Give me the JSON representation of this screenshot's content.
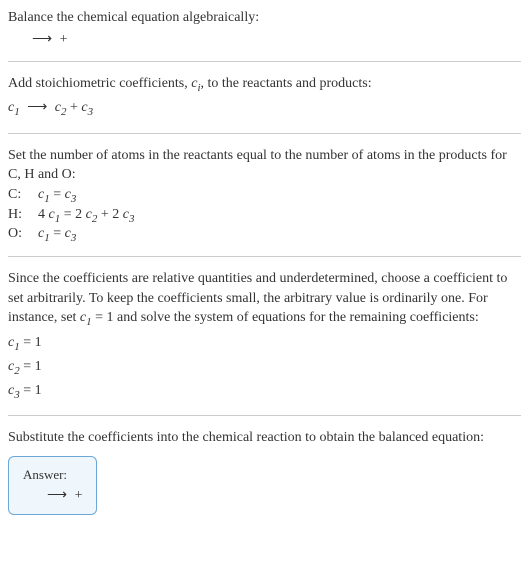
{
  "section1": {
    "line1": "Balance the chemical equation algebraically:",
    "line2_arrow": "⟶",
    "line2_plus": "+"
  },
  "section2": {
    "line1_a": "Add stoichiometric coefficients, ",
    "line1_ci": "c",
    "line1_ci_sub": "i",
    "line1_b": ", to the reactants and products:",
    "line2_c1": "c",
    "line2_c1_sub": "1",
    "line2_arrow": "⟶",
    "line2_c2": "c",
    "line2_c2_sub": "2",
    "line2_plus": " + ",
    "line2_c3": "c",
    "line2_c3_sub": "3"
  },
  "section3": {
    "line1": "Set the number of atoms in the reactants equal to the number of atoms in the products for C, H and O:",
    "eqs": [
      {
        "label": "C:",
        "lhs_c": "c",
        "lhs_sub": "1",
        "eq": " = ",
        "rhs_c": "c",
        "rhs_sub": "3"
      },
      {
        "label": "H:",
        "lhs_pre": "4 ",
        "lhs_c": "c",
        "lhs_sub": "1",
        "eq": " = 2 ",
        "mid_c": "c",
        "mid_sub": "2",
        "plus": " + 2 ",
        "rhs_c": "c",
        "rhs_sub": "3"
      },
      {
        "label": "O:",
        "lhs_c": "c",
        "lhs_sub": "1",
        "eq": " = ",
        "rhs_c": "c",
        "rhs_sub": "3"
      }
    ]
  },
  "section4": {
    "line1_a": "Since the coefficients are relative quantities and underdetermined, choose a coefficient to set arbitrarily. To keep the coefficients small, the arbitrary value is ordinarily one. For instance, set ",
    "line1_c": "c",
    "line1_c_sub": "1",
    "line1_b": " = 1 and solve the system of equations for the remaining coefficients:",
    "coeffs": [
      {
        "c": "c",
        "sub": "1",
        "val": " = 1"
      },
      {
        "c": "c",
        "sub": "2",
        "val": " = 1"
      },
      {
        "c": "c",
        "sub": "3",
        "val": " = 1"
      }
    ]
  },
  "section5": {
    "line1": "Substitute the coefficients into the chemical reaction to obtain the balanced equation:",
    "answer_label": "Answer:",
    "answer_arrow": "⟶",
    "answer_plus": "+"
  }
}
